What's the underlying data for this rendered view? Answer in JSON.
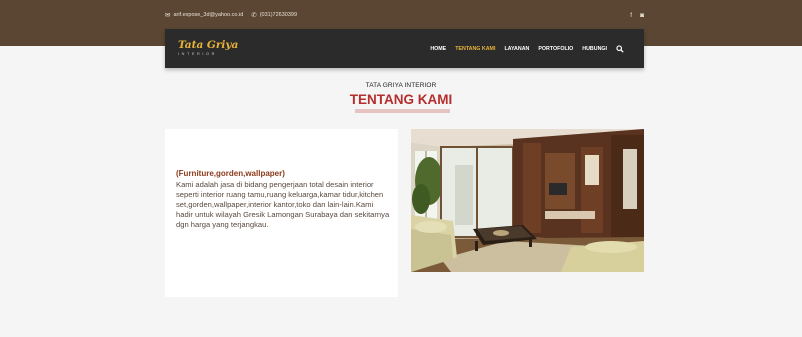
{
  "topbar": {
    "email": "arif.expose_3d@yahoo.co.id",
    "phone": "(031)72630399",
    "icons": [
      "mail-icon",
      "phone-icon",
      "facebook-icon",
      "instagram-icon"
    ]
  },
  "brand": {
    "name": "Tata Griya",
    "tagline": "INTERIOR",
    "accent": "#e8b43a"
  },
  "nav": {
    "items": [
      {
        "label": "HOME"
      },
      {
        "label": "TENTANG KAMI",
        "active": true
      },
      {
        "label": "LAYANAN"
      },
      {
        "label": "PORTOFOLIO"
      },
      {
        "label": "HUBUNGI"
      }
    ]
  },
  "section": {
    "kicker": "TATA GRIYA INTERIOR",
    "heading": "TENTANG KAMI",
    "heading_color": "#b52d2d"
  },
  "about": {
    "title": "(Furniture,gorden,wallpaper)",
    "text": "Kami adalah jasa di bidang pengerjaan total desain interior seperti interior ruang tamu,ruang keluarga,kamar tidur,kitchen set,gorden,wallpaper,interior kantor,toko dan lain-lain.Kami hadir untuk wilayah Gresik Lamongan Surabaya dan sekitarnya dgn harga yang terjangkau."
  },
  "colors": {
    "topband": "#5a4632",
    "navbar": "#2b2b2b",
    "page_bg": "#f6f5f5"
  }
}
